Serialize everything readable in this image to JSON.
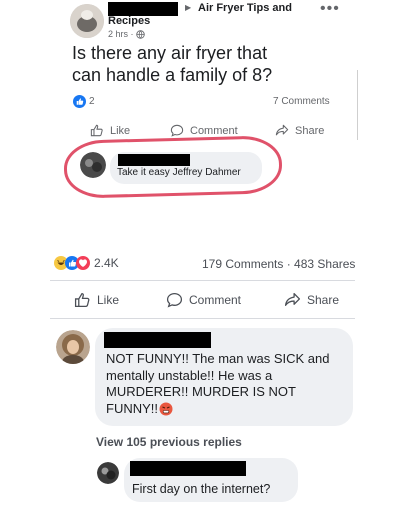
{
  "shared_post": {
    "group_name": "Air Fryer Tips and",
    "group_name_line2": "Recipes",
    "meta": "2 hrs · ",
    "question": "Is there any air fryer that can handle a family of 8?",
    "reaction_count": "2",
    "comments_count": "7 Comments",
    "actions": {
      "like": "Like",
      "comment": "Comment",
      "share": "Share"
    },
    "reply": {
      "text": "Take it easy Jeffrey Dahmer"
    },
    "highlight_color": "#e0526a"
  },
  "post_footer": {
    "reaction_count": "2.4K",
    "comments_shares": "179 Comments · 483 Shares",
    "actions": {
      "like": "Like",
      "comment": "Comment",
      "share": "Share"
    }
  },
  "comments": {
    "first": {
      "text_lines": [
        "NOT FUNNY!! The man was SICK and",
        "mentally unstable!! He was a",
        "MURDERER!! MURDER IS NOT",
        "FUNNY!!"
      ],
      "emoji": "angry-face"
    },
    "view_previous": "View 105 previous replies",
    "reply": {
      "text": "First day on the internet?"
    }
  },
  "colors": {
    "link_blue": "#1877f2",
    "muted_gray": "#65676b",
    "bubble_bg": "#eef0f3"
  }
}
